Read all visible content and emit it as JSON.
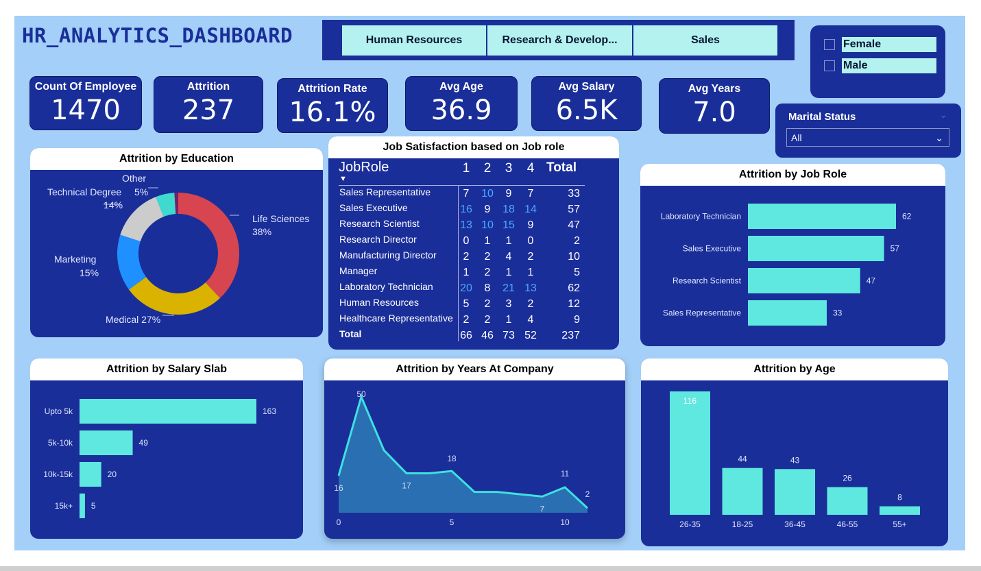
{
  "title": "HR_ANALYTICS_DASHBOARD",
  "departments": [
    "Human Resources",
    "Research & Develop...",
    "Sales"
  ],
  "gender": [
    "Female",
    "Male"
  ],
  "kpis": {
    "count": {
      "label": "Count Of Employee",
      "value": "1470"
    },
    "attrition": {
      "label": "Attrition",
      "value": "237"
    },
    "rate": {
      "label": "Attrition Rate",
      "value": "16.1%"
    },
    "age": {
      "label": "Avg Age",
      "value": "36.9"
    },
    "salary": {
      "label": "Avg Salary",
      "value": "6.5K"
    },
    "years": {
      "label": "Avg Years",
      "value": "7.0"
    }
  },
  "marital": {
    "label": "Marital Status",
    "selected": "All"
  },
  "education": {
    "title": "Attrition by Education",
    "slices": [
      {
        "name": "Life Sciences",
        "pct": 38,
        "color": "#d64550"
      },
      {
        "name": "Medical",
        "pct": 27,
        "color": "#d9b300"
      },
      {
        "name": "Marketing",
        "pct": 15,
        "color": "#1e90ff"
      },
      {
        "name": "Technical Degree",
        "pct": 14,
        "color": "#cccccc"
      },
      {
        "name": "Other",
        "pct": 5,
        "color": "#3fd9cf"
      },
      {
        "name": "",
        "pct": 1,
        "color": "#7a1f6b"
      }
    ],
    "labels": {
      "life1": "Life Sciences",
      "life2": "38%",
      "medical": "Medical 27%",
      "mkt1": "Marketing",
      "mkt2": "15%",
      "tech1": "Technical Degree",
      "tech2": "14%",
      "other1": "Other",
      "other2": "5%"
    }
  },
  "jobsat": {
    "title": "Job Satisfaction based on Job role",
    "header": [
      "JobRole",
      "1",
      "2",
      "3",
      "4",
      "Total"
    ],
    "rows": [
      {
        "role": "Sales Representative",
        "v": [
          "7",
          "10",
          "9",
          "7"
        ],
        "total": "33"
      },
      {
        "role": "Sales Executive",
        "v": [
          "16",
          "9",
          "18",
          "14"
        ],
        "total": "57"
      },
      {
        "role": "Research Scientist",
        "v": [
          "13",
          "10",
          "15",
          "9"
        ],
        "total": "47"
      },
      {
        "role": "Research Director",
        "v": [
          "0",
          "1",
          "1",
          "0"
        ],
        "total": "2"
      },
      {
        "role": "Manufacturing Director",
        "v": [
          "2",
          "2",
          "4",
          "2"
        ],
        "total": "10"
      },
      {
        "role": "Manager",
        "v": [
          "1",
          "2",
          "1",
          "1"
        ],
        "total": "5"
      },
      {
        "role": "Laboratory Technician",
        "v": [
          "20",
          "8",
          "21",
          "13"
        ],
        "total": "62"
      },
      {
        "role": "Human Resources",
        "v": [
          "5",
          "2",
          "3",
          "2"
        ],
        "total": "12"
      },
      {
        "role": "Healthcare Representative",
        "v": [
          "2",
          "2",
          "1",
          "4"
        ],
        "total": "9"
      }
    ],
    "total": {
      "role": "Total",
      "v": [
        "66",
        "46",
        "73",
        "52"
      ],
      "total": "237"
    },
    "colors": {
      "high": "#4aa8ff",
      "normal": "#ffffff"
    }
  },
  "jobrole": {
    "title": "Attrition by Job Role",
    "categories": [
      "Laboratory Technician",
      "Sales Executive",
      "Research Scientist",
      "Sales Representative"
    ],
    "values": [
      62,
      57,
      47,
      33
    ],
    "value_labels": [
      "62",
      "57",
      "47",
      "33"
    ]
  },
  "salary": {
    "title": "Attrition by Salary Slab",
    "categories": [
      "Upto 5k",
      "5k-10k",
      "10k-15k",
      "15k+"
    ],
    "values": [
      163,
      49,
      20,
      5
    ],
    "value_labels": [
      "163",
      "49",
      "20",
      "5"
    ]
  },
  "years": {
    "title": "Attrition by Years At Company",
    "x_ticks": [
      "0",
      "5",
      "10"
    ],
    "point_labels": [
      "16",
      "50",
      "17",
      "18",
      "7",
      "11",
      "2"
    ]
  },
  "age": {
    "title": "Attrition by Age",
    "categories": [
      "26-35",
      "18-25",
      "36-45",
      "46-55",
      "55+"
    ],
    "values": [
      116,
      44,
      43,
      26,
      8
    ],
    "value_labels": [
      "116",
      "44",
      "43",
      "26",
      "8"
    ]
  },
  "chart_data": [
    {
      "type": "pie",
      "title": "Attrition by Education",
      "categories": [
        "Life Sciences",
        "Medical",
        "Marketing",
        "Technical Degree",
        "Other"
      ],
      "values": [
        38,
        27,
        15,
        14,
        5
      ]
    },
    {
      "type": "table",
      "title": "Job Satisfaction based on Job role"
    },
    {
      "type": "bar",
      "title": "Attrition by Job Role",
      "categories": [
        "Laboratory Technician",
        "Sales Executive",
        "Research Scientist",
        "Sales Representative"
      ],
      "values": [
        62,
        57,
        47,
        33
      ]
    },
    {
      "type": "bar",
      "title": "Attrition by Salary Slab",
      "categories": [
        "Upto 5k",
        "5k-10k",
        "10k-15k",
        "15k+"
      ],
      "values": [
        163,
        49,
        20,
        5
      ]
    },
    {
      "type": "area",
      "title": "Attrition by Years At Company",
      "x": [
        0,
        1,
        2,
        3,
        4,
        5,
        6,
        7,
        8,
        9,
        10,
        11
      ],
      "values": [
        16,
        50,
        27,
        17,
        17,
        18,
        9,
        9,
        8,
        7,
        11,
        2
      ],
      "xlim": [
        0,
        11
      ]
    },
    {
      "type": "bar",
      "title": "Attrition by Age",
      "categories": [
        "26-35",
        "18-25",
        "36-45",
        "46-55",
        "55+"
      ],
      "values": [
        116,
        44,
        43,
        26,
        8
      ]
    }
  ]
}
